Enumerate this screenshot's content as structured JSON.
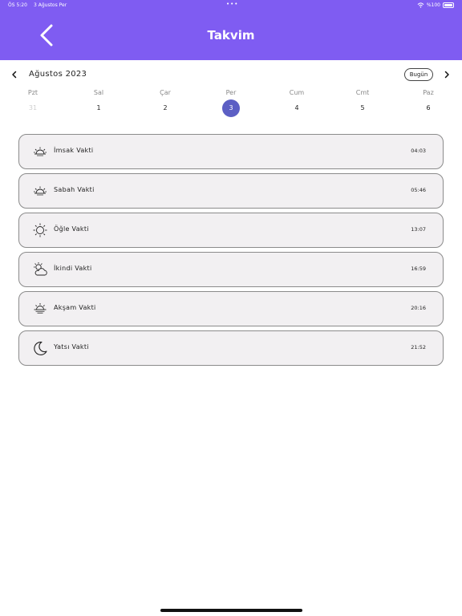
{
  "status_bar": {
    "time": "ÖS 5:20",
    "date": "3 Ağustos Per",
    "dots": "•••",
    "battery": "%100"
  },
  "header": {
    "title": "Takvim"
  },
  "calendar": {
    "month_label": "Ağustos 2023",
    "today_label": "Bugün",
    "weekdays": [
      "Pzt",
      "Sal",
      "Çar",
      "Per",
      "Cum",
      "Cmt",
      "Paz"
    ],
    "days": [
      "31",
      "1",
      "2",
      "3",
      "4",
      "5",
      "6"
    ],
    "selected_day": "3"
  },
  "prayers": [
    {
      "label": "İmsak Vakti",
      "time": "04:03",
      "icon": "sunrise-icon"
    },
    {
      "label": "Sabah Vakti",
      "time": "05:46",
      "icon": "sunrise-icon"
    },
    {
      "label": "Öğle Vakti",
      "time": "13:07",
      "icon": "sun-icon"
    },
    {
      "label": "İkindi Vakti",
      "time": "16:59",
      "icon": "cloud-sun-icon"
    },
    {
      "label": "Akşam Vakti",
      "time": "20:16",
      "icon": "sunset-icon"
    },
    {
      "label": "Yatsı Vakti",
      "time": "21:52",
      "icon": "moon-icon"
    }
  ],
  "colors": {
    "header": "#7f5cf2",
    "selected_day": "#5c5fc4",
    "card_bg": "#f2f0f2"
  }
}
